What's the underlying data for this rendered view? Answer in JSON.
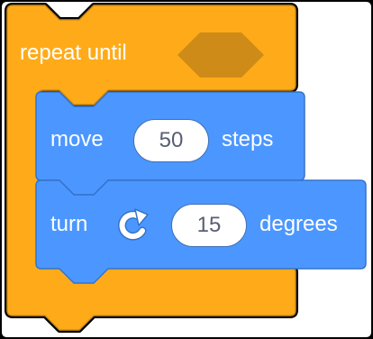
{
  "repeat_block": {
    "label": "repeat until",
    "color": "#ffab19",
    "border_color": "#cf8b17",
    "condition_slot_color": "#cf8b17"
  },
  "move_block": {
    "label_before": "move",
    "steps_value": "50",
    "label_after": "steps",
    "color": "#4c97ff",
    "border_color": "#3373cc"
  },
  "turn_block": {
    "label_before": "turn",
    "icon": "rotate-clockwise-icon",
    "degrees_value": "15",
    "label_after": "degrees",
    "color": "#4c97ff",
    "border_color": "#3373cc"
  },
  "background_color": "#ffffff"
}
